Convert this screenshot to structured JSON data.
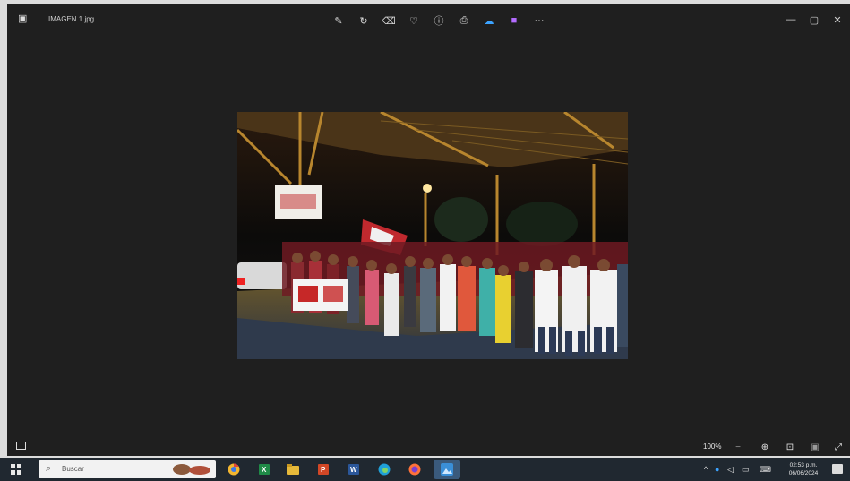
{
  "window": {
    "title": "IMAGEN 1.jpg",
    "toolbar": [
      {
        "name": "edit-icon",
        "glyph": "✎"
      },
      {
        "name": "rotate-icon",
        "glyph": "↻"
      },
      {
        "name": "delete-icon",
        "glyph": "🗑"
      },
      {
        "name": "favorite-icon",
        "glyph": "♡"
      },
      {
        "name": "info-icon",
        "glyph": "ⓘ"
      },
      {
        "name": "print-icon",
        "glyph": "⎙"
      },
      {
        "name": "onedrive-icon",
        "glyph": "☁"
      },
      {
        "name": "clipchamp-icon",
        "glyph": "■"
      },
      {
        "name": "more-icon",
        "glyph": "···"
      }
    ],
    "controls": {
      "minimize": "—",
      "maximize": "▢",
      "close": "✕"
    }
  },
  "status": {
    "zoom": "100%",
    "buttons": [
      {
        "name": "zoom-out-icon",
        "glyph": "−"
      },
      {
        "name": "zoom-in-icon",
        "glyph": "⊕"
      },
      {
        "name": "fit-window-icon",
        "glyph": "⊡"
      },
      {
        "name": "actual-size-icon",
        "glyph": "⤢"
      },
      {
        "name": "fullscreen-icon",
        "glyph": "⤢"
      }
    ]
  },
  "taskbar": {
    "search_placeholder": "Buscar",
    "apps": [
      {
        "name": "chrome-icon",
        "color": "#f2b630"
      },
      {
        "name": "excel-icon",
        "color": "#1f8a47"
      },
      {
        "name": "file-explorer-icon",
        "color": "#e6b93a"
      },
      {
        "name": "powerpoint-icon",
        "color": "#d24726"
      },
      {
        "name": "word-icon",
        "color": "#2b579a"
      },
      {
        "name": "edge-icon",
        "color": "#1fa0d8"
      },
      {
        "name": "firefox-icon",
        "color": "#ff7139"
      },
      {
        "name": "photos-icon",
        "color": "#3a8fd8"
      }
    ],
    "clock_time": "02:53 p.m.",
    "clock_date": "06/06/2024"
  }
}
